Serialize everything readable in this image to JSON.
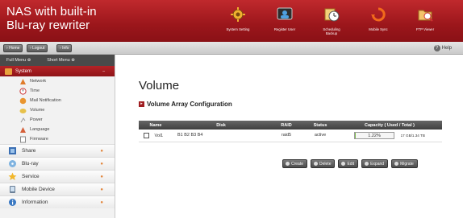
{
  "header": {
    "brand_line1": "NAS with built-in",
    "brand_line2": "Blu-ray rewriter",
    "nav": [
      {
        "label": "System Setting",
        "icon": "gear-icon"
      },
      {
        "label": "Register User",
        "icon": "user-icon"
      },
      {
        "label": "Scheduling\nBackup",
        "icon": "schedule-backup-icon"
      },
      {
        "label": "Mobile Sync",
        "icon": "sync-icon"
      },
      {
        "label": "FTP Viewer",
        "icon": "ftp-icon"
      }
    ]
  },
  "toolbar": {
    "home": "Home",
    "logout": "Logout",
    "info": "Info",
    "help": "Help"
  },
  "sidebar": {
    "full_menu": "Full Menu",
    "short_menu": "Short Menu",
    "system": {
      "label": "System",
      "items": [
        "Network",
        "Time",
        "Mail Notification",
        "Volume",
        "Power",
        "Language",
        "Firmware"
      ]
    },
    "categories": [
      "Share",
      "Blu-ray",
      "Service",
      "Mobile Device",
      "Information"
    ]
  },
  "main": {
    "title": "Volume",
    "subtitle": "Volume Array Configuration",
    "table": {
      "headers": [
        "Name",
        "Disk",
        "RAID",
        "Status",
        "Capacity ( Used / Total )"
      ],
      "rows": [
        {
          "name": "Vol1",
          "disk": "B1 B2 B3 B4",
          "raid": "raid5",
          "status": "active",
          "capacity_pct": "1.22%",
          "capacity_total": "17 GB/1.34 TB"
        }
      ]
    },
    "actions": [
      "Create",
      "Delete",
      "Edit",
      "Expand",
      "Migrate"
    ]
  },
  "colors": {
    "brand_red": "#a91d22",
    "progress_green": "#7fbf4f"
  }
}
